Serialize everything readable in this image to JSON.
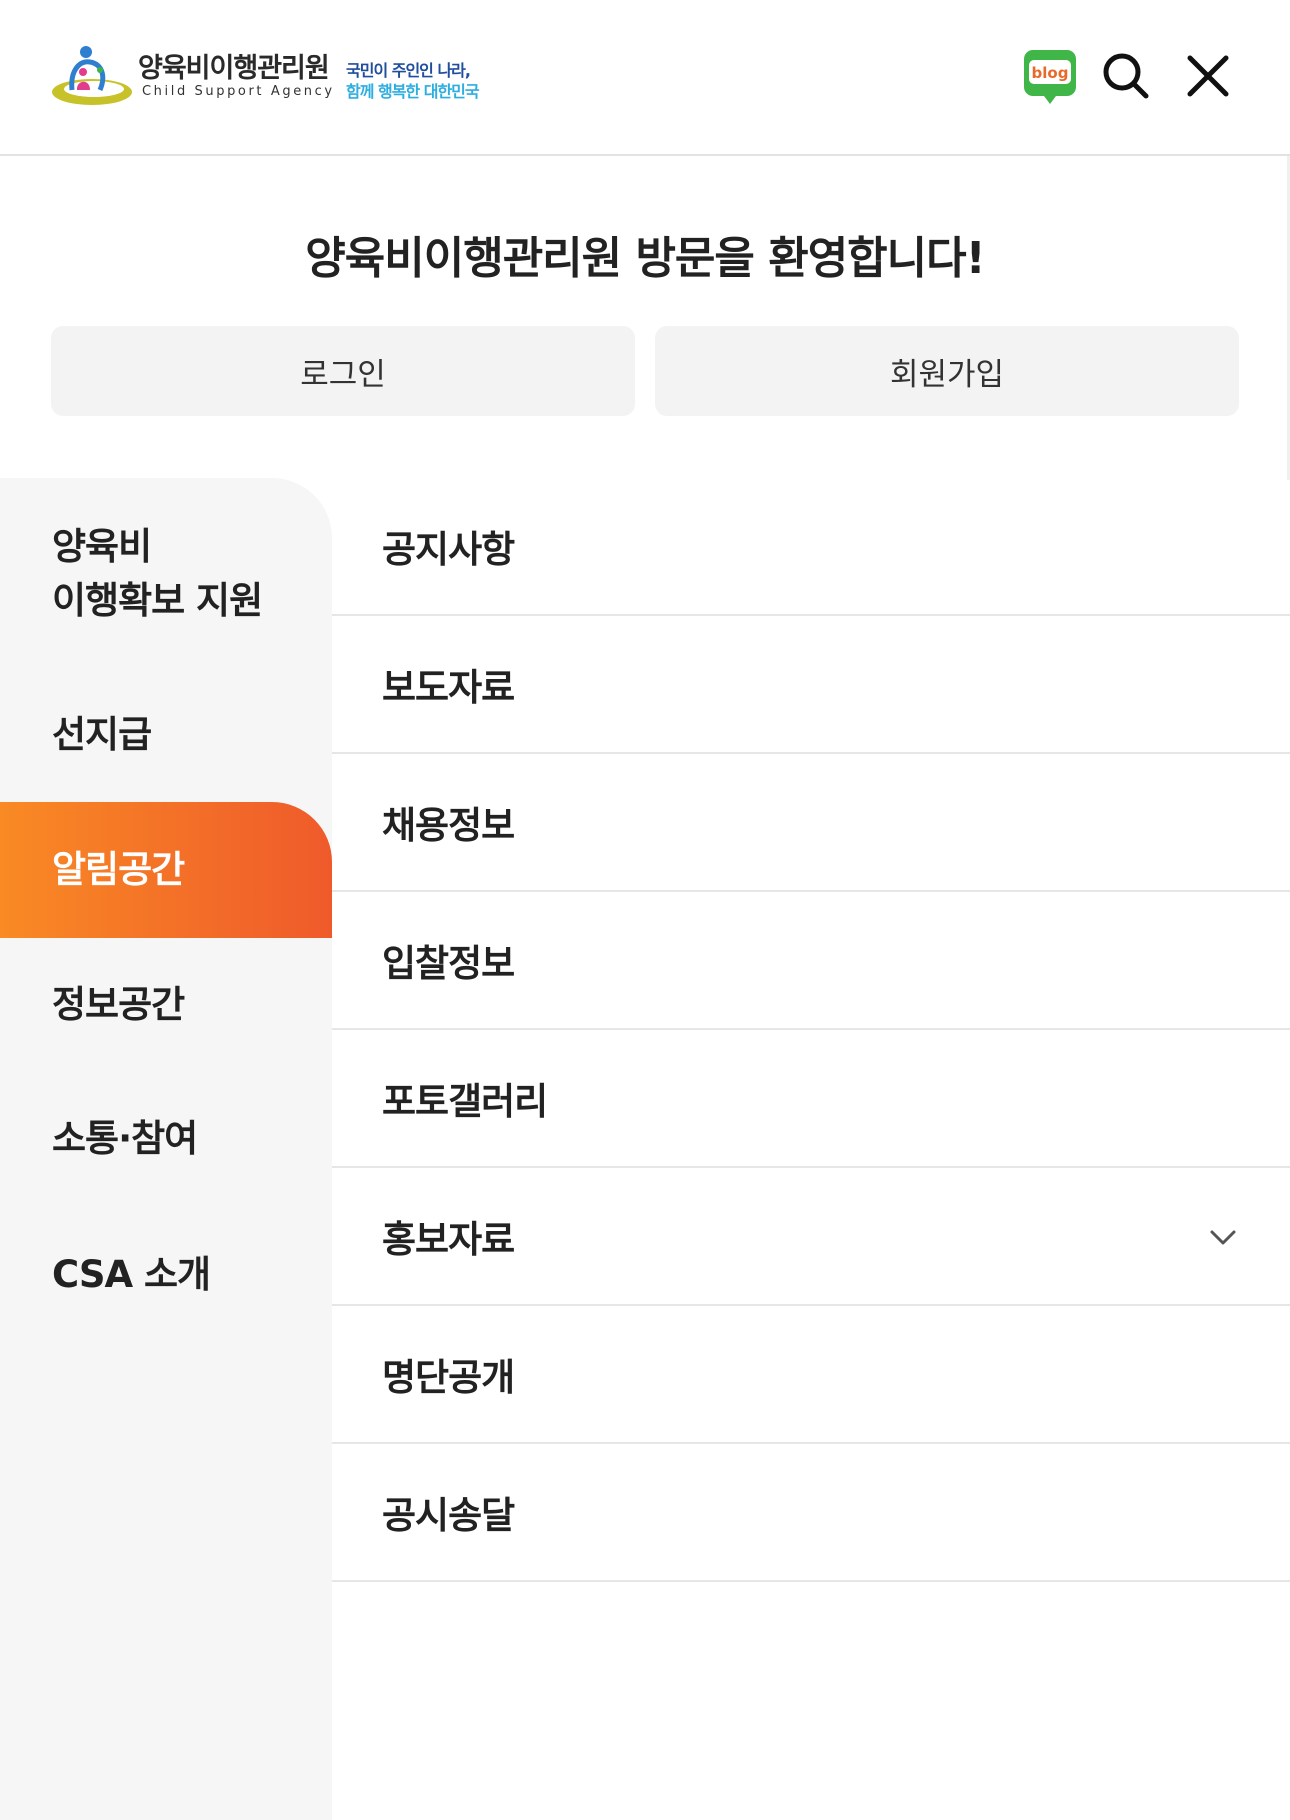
{
  "header": {
    "logo_title": "양육비이행관리원",
    "logo_subtitle": "Child Support Agency",
    "slogan_line1": "국민이 주인인 나라,",
    "slogan_line2": "함께 행복한 대한민국",
    "blog_label": "blog",
    "icons": [
      "logo-mark",
      "blog-icon",
      "search-icon",
      "close-icon"
    ],
    "colors": {
      "accent": "#f98a24",
      "accent2": "#ef5a2b",
      "blog_green": "#41b648",
      "slogan_blue": "#1f4e9c",
      "slogan_cyan": "#2eaee0"
    }
  },
  "welcome": {
    "title": "양육비이행관리원 방문을 환영합니다!",
    "login_label": "로그인",
    "join_label": "회원가입"
  },
  "menu": {
    "categories": [
      "양육비\n이행확보 지원",
      "선지급",
      "알림공간",
      "정보공간",
      "소통·참여",
      "CSA 소개"
    ],
    "active_category": "알림공간",
    "subitems": [
      "공지사항",
      "보도자료",
      "채용정보",
      "입찰정보",
      "포토갤러리",
      "홍보자료",
      "명단공개",
      "공시송달"
    ],
    "expandable_item": "홍보자료"
  }
}
